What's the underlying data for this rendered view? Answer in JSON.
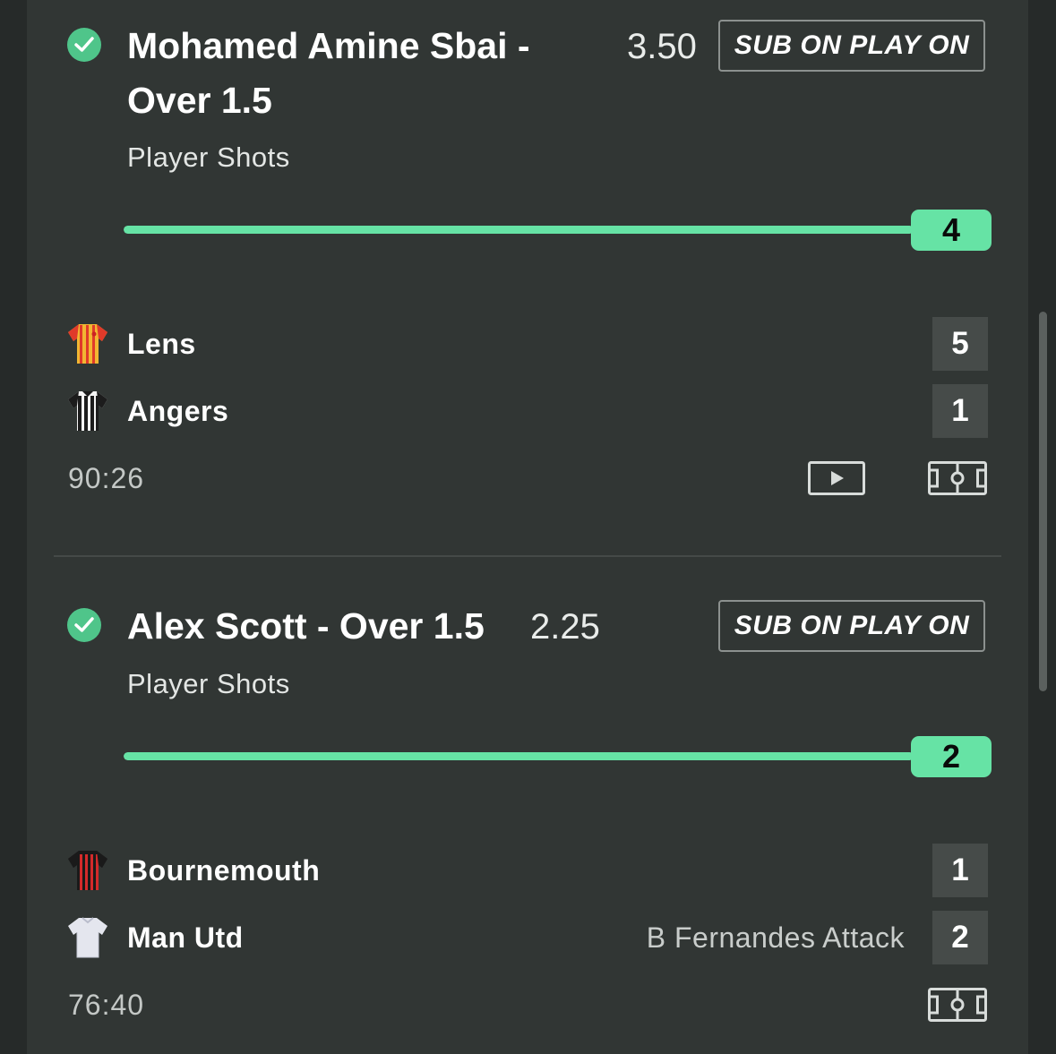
{
  "colors": {
    "background": "#262a29",
    "panel": "#313634",
    "accent": "#66e3a5",
    "check": "#4fc58a",
    "score_box": "#464b49"
  },
  "bets": [
    {
      "status_icon": "check-circle-icon",
      "selection": "Mohamed Amine Sbai - Over 1.5",
      "odds": "3.50",
      "action_label": "SUB ON PLAY ON",
      "market": "Player Shots",
      "progress_value": "4",
      "progress_fraction": 1.0,
      "teams": [
        {
          "name": "Lens",
          "score": "5",
          "kit_icon": "lens-kit-icon",
          "event": ""
        },
        {
          "name": "Angers",
          "score": "1",
          "kit_icon": "angers-kit-icon",
          "event": ""
        }
      ],
      "clock": "90:26",
      "actions": [
        "play-video-icon",
        "pitch-icon"
      ]
    },
    {
      "status_icon": "check-circle-icon",
      "selection": "Alex Scott - Over 1.5",
      "odds": "2.25",
      "action_label": "SUB ON PLAY ON",
      "market": "Player Shots",
      "progress_value": "2",
      "progress_fraction": 1.0,
      "teams": [
        {
          "name": "Bournemouth",
          "score": "1",
          "kit_icon": "bournemouth-kit-icon",
          "event": ""
        },
        {
          "name": "Man Utd",
          "score": "2",
          "kit_icon": "man-utd-kit-icon",
          "event": "B Fernandes Attack"
        }
      ],
      "clock": "76:40",
      "actions": [
        "pitch-icon"
      ]
    }
  ]
}
